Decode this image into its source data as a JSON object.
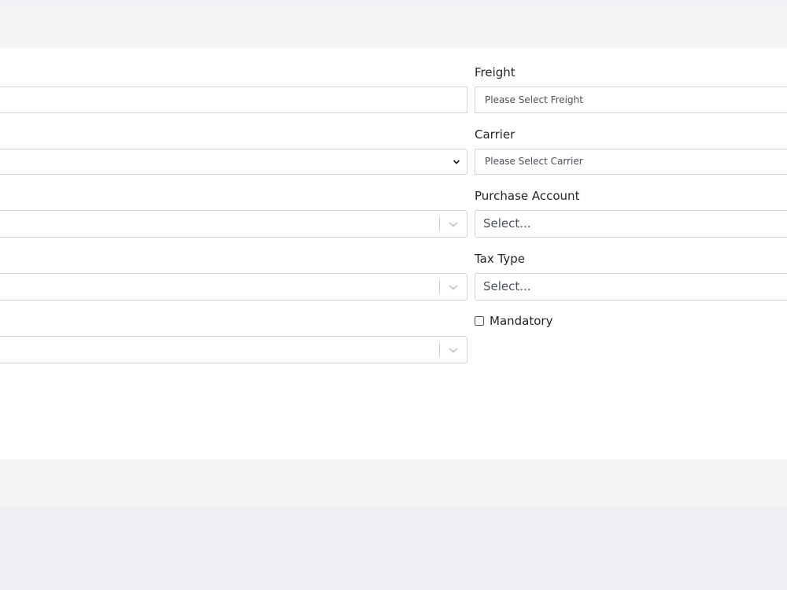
{
  "form": {
    "freight": {
      "label": "Freight",
      "placeholder": "Please Select Freight"
    },
    "carrier": {
      "label": "Carrier",
      "placeholder": "Please Select Carrier"
    },
    "purchase_account": {
      "label": "Purchase Account",
      "placeholder": "Select..."
    },
    "tax_type": {
      "label": "Tax Type",
      "placeholder": "Select..."
    },
    "mandatory": {
      "label": "Mandatory",
      "checked": false
    }
  },
  "icons": {
    "native_select_caret": "chevron-down-icon",
    "react_select_indicator": "chevron-down-icon"
  },
  "colors": {
    "modal_header_bg": "#f5f5f5",
    "modal_body_bg": "#ffffff",
    "page_bg": "#eff0f4",
    "border": "#ced4da",
    "label_text": "#212529",
    "placeholder_text": "#495057"
  }
}
